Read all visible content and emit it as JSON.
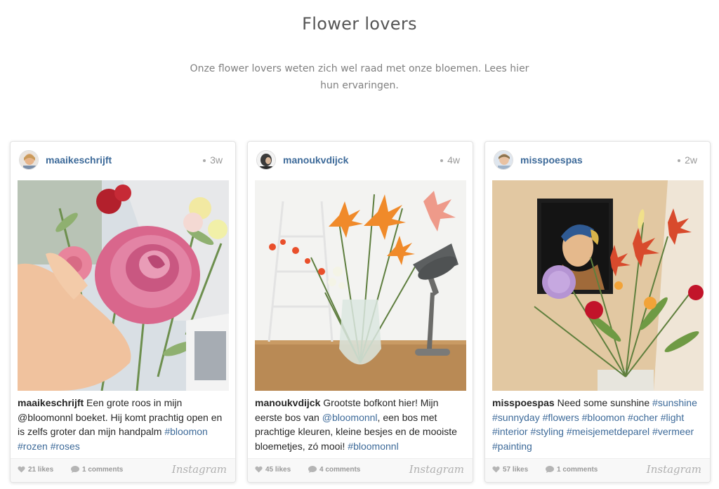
{
  "section": {
    "title": "Flower lovers",
    "intro": "Onze flower lovers weten zich wel raad met onze bloemen. Lees hier hun ervaringen."
  },
  "posts": [
    {
      "username": "maaikeschrijft",
      "age": "3w",
      "caption_user": "maaikeschrijft",
      "caption_text": " Een grote roos in mijn @bloomonnl boeket. Hij komt prachtig open en is zelfs groter dan mijn handpalm ",
      "tags": [
        "#bloomon",
        "#rozen",
        "#roses"
      ],
      "likes": "21 likes",
      "comments": "1 comments",
      "brand": "Instagram"
    },
    {
      "username": "manoukvdijck",
      "age": "4w",
      "caption_user": "manoukvdijck",
      "caption_before": " Grootste bofkont hier! Mijn eerste bos van ",
      "caption_mention": "@bloomonnl",
      "caption_after": ", een bos met prachtige kleuren, kleine besjes en de mooiste bloemetjes, zó mooi! ",
      "tags": [
        "#bloomonnl"
      ],
      "likes": "45 likes",
      "comments": "4 comments",
      "brand": "Instagram"
    },
    {
      "username": "misspoespas",
      "age": "2w",
      "caption_user": "misspoespas",
      "caption_text": " Need some sunshine ",
      "tags": [
        "#sunshine",
        "#sunnyday",
        "#flowers",
        "#bloomon",
        "#ocher",
        "#light",
        "#interior",
        "#styling",
        "#meisjemetdeparel",
        "#vermeer",
        "#painting"
      ],
      "likes": "57 likes",
      "comments": "1 comments",
      "brand": "Instagram"
    }
  ],
  "colors": {
    "username": "#3d6a99",
    "hashtag": "#3d6a99",
    "footer_bg": "#f8f8f8"
  },
  "icons": [
    "heart-icon",
    "comment-icon",
    "instagram-logo"
  ]
}
